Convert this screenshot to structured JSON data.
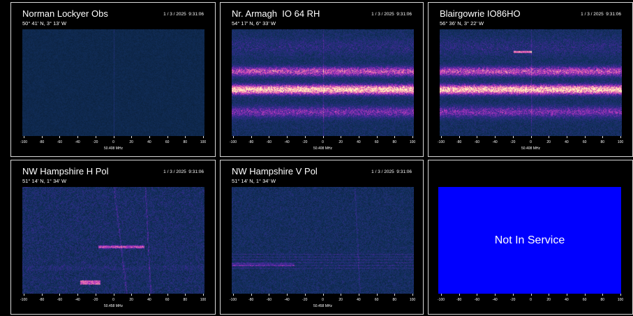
{
  "axis": {
    "ticks": [
      "-100",
      "-80",
      "-60",
      "-40",
      "-20",
      "0",
      "20",
      "40",
      "60",
      "80",
      "100"
    ],
    "center_freq": "50.408 MHz"
  },
  "colors": {
    "background": "#000000",
    "border": "#d8d8d8",
    "not_in_service_bg": "#0000ff"
  },
  "panels": [
    {
      "id": "norman-lockyer",
      "title": "Norman Lockyer Obs",
      "coords": "50° 41' N, 3° 13' W",
      "timestamp": "1 / 3 / 2025  9:31:06",
      "status": "active",
      "axis_label": "50.408 MHz"
    },
    {
      "id": "nr-armagh",
      "title": "Nr. Armagh  IO 64 RH",
      "coords": "54° 17' N, 6° 33' W",
      "timestamp": "1 / 3 / 2025  9:31:06",
      "status": "active",
      "axis_label": "50.408 MHz"
    },
    {
      "id": "blairgowrie",
      "title": "Blairgowrie IO86HO",
      "coords": "56° 36' N, 3° 22' W",
      "timestamp": "1 / 3 / 2025  9:31:06",
      "status": "active",
      "axis_label": "50.408 MHz"
    },
    {
      "id": "nw-hampshire-h",
      "title": "NW Hampshire H Pol",
      "coords": "51° 14' N, 1° 34' W",
      "timestamp": "1 / 3 / 2025  9:31:06",
      "status": "active",
      "axis_label": "50.458 MHz"
    },
    {
      "id": "nw-hampshire-v",
      "title": "NW Hampshire V Pol",
      "coords": "51° 14' N, 1° 34' W",
      "timestamp": "1 / 3 / 2025  9:31:06",
      "status": "active",
      "axis_label": "50.458 MHz"
    },
    {
      "id": "not-in-service",
      "title": "",
      "coords": "",
      "timestamp": "",
      "status": "Not In Service",
      "axis_label": ""
    }
  ]
}
